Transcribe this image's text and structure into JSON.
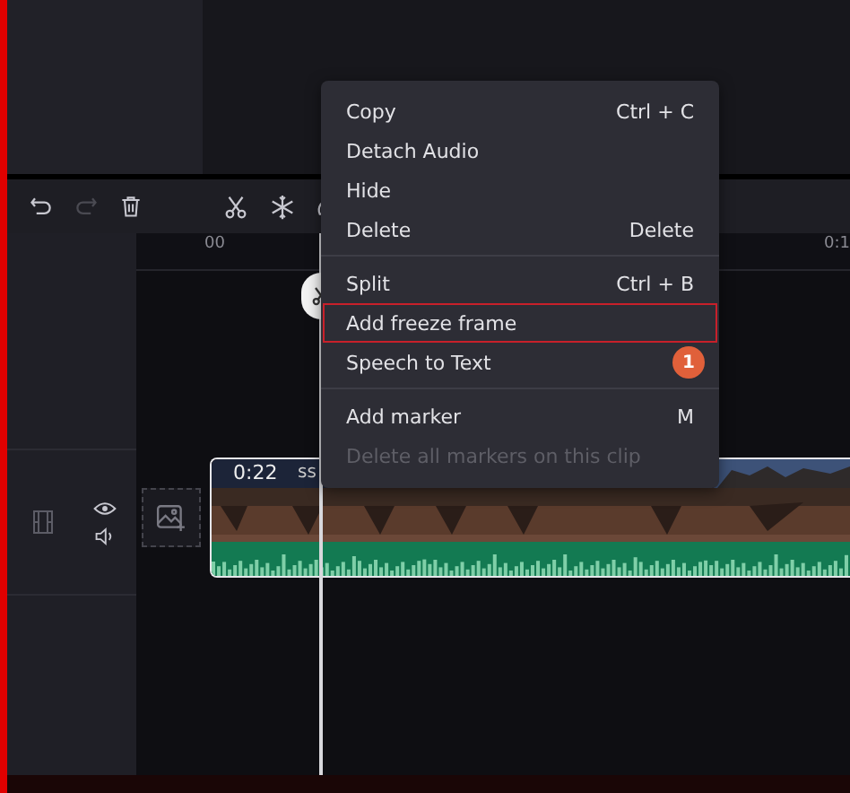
{
  "toolbar": {
    "redo_disabled": true
  },
  "ruler": {
    "labels": [
      "00",
      "0:1"
    ]
  },
  "clip": {
    "time": "0:22",
    "name": "ss"
  },
  "context_menu": {
    "groups": [
      [
        {
          "label": "Copy",
          "shortcut": "Ctrl + C",
          "disabled": false,
          "highlighted": false
        },
        {
          "label": "Detach Audio",
          "disabled": false,
          "highlighted": false
        },
        {
          "label": "Hide",
          "disabled": false,
          "highlighted": false
        },
        {
          "label": "Delete",
          "shortcut": "Delete",
          "disabled": false,
          "highlighted": false
        }
      ],
      [
        {
          "label": "Split",
          "shortcut": "Ctrl + B",
          "disabled": false,
          "highlighted": false
        },
        {
          "label": "Add freeze frame",
          "disabled": false,
          "highlighted": true
        },
        {
          "label": "Speech to Text",
          "disabled": false,
          "highlighted": false
        }
      ],
      [
        {
          "label": "Add marker",
          "shortcut": "M",
          "disabled": false,
          "highlighted": false
        },
        {
          "label": "Delete all markers on this clip",
          "disabled": true,
          "highlighted": false
        }
      ]
    ],
    "callout": "1"
  }
}
